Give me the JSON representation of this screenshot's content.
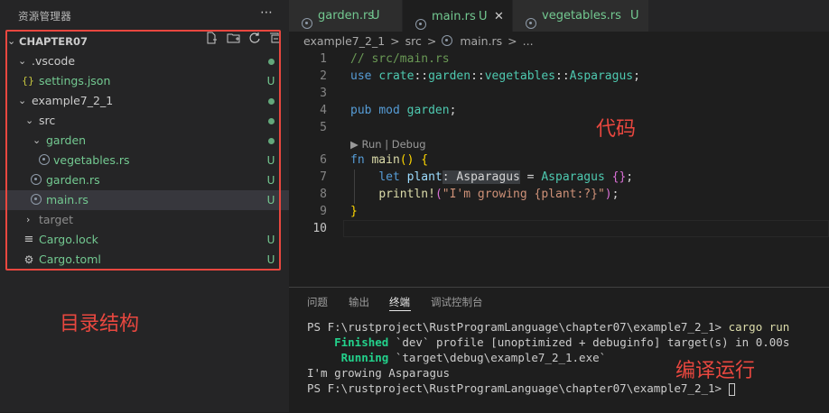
{
  "sidebar": {
    "title": "资源管理器",
    "more_icon": "ellipsis-icon",
    "folder_name": "CHAPTER07",
    "header_icons": [
      "new-file-icon",
      "new-folder-icon",
      "refresh-icon",
      "collapse-all-icon"
    ],
    "items": [
      {
        "label": ".vscode",
        "status": "dot"
      },
      {
        "label": "settings.json",
        "icon_text": "{}",
        "status": "U"
      },
      {
        "label": "example7_2_1",
        "status": "dot"
      },
      {
        "label": "src",
        "status": "dot"
      },
      {
        "label": "garden",
        "status": "dot"
      },
      {
        "label": "vegetables.rs",
        "status": "U"
      },
      {
        "label": "garden.rs",
        "status": "U"
      },
      {
        "label": "main.rs",
        "status": "U"
      },
      {
        "label": "target",
        "status": ""
      },
      {
        "label": "Cargo.lock",
        "icon_text": "≡",
        "status": "U"
      },
      {
        "label": "Cargo.toml",
        "icon_text": "⚙",
        "status": "U"
      }
    ]
  },
  "tabs": [
    {
      "name": "garden.rs",
      "status": "U"
    },
    {
      "name": "main.rs",
      "status": "U",
      "close": "✕"
    },
    {
      "name": "vegetables.rs",
      "status": "U"
    }
  ],
  "breadcrumb": [
    "example7_2_1",
    ">",
    "src",
    ">",
    "main.rs",
    ">",
    "..."
  ],
  "editor": {
    "line_numbers": [
      "1",
      "2",
      "3",
      "4",
      "5",
      "6",
      "7",
      "8",
      "9",
      "10"
    ],
    "codelens": "▶ Run | Debug",
    "lines": {
      "l1": "// src/main.rs",
      "l2_kw": "use",
      "l2_mod1": "crate",
      "l2_sep1": "::",
      "l2_mod2": "garden",
      "l2_sep2": "::",
      "l2_mod3": "vegetables",
      "l2_sep3": "::",
      "l2_ty": "Asparagus",
      "l2_end": ";",
      "l4_kw1": "pub",
      "l4_kw2": "mod",
      "l4_name": "garden",
      "l4_end": ";",
      "l6_kw": "fn",
      "l6_name": "main",
      "l6_parens": "()",
      "l6_brace": "{",
      "l7_kw": "let",
      "l7_var": "plant",
      "l7_hint": ": Asparagus",
      "l7_eq": " = ",
      "l7_ty": "Asparagus",
      "l7_braces": "{}",
      "l7_end": ";",
      "l8_macro": "println!",
      "l8_open": "(",
      "l8_str": "\"I'm growing {plant:?}\"",
      "l8_close": ")",
      "l8_end": ";",
      "l9_brace": "}"
    }
  },
  "panel": {
    "tabs": [
      "问题",
      "输出",
      "终端",
      "调试控制台"
    ],
    "active_tab": "终端",
    "terminal": {
      "prompt1": "PS F:\\rustproject\\RustProgramLanguage\\chapter07\\example7_2_1> ",
      "cmd1": "cargo run",
      "finished_word": "Finished",
      "finished_rest": " `dev` profile [unoptimized + debuginfo] target(s) in 0.00s",
      "running_word": "Running",
      "running_rest": " `target\\debug\\example7_2_1.exe`",
      "output": "I'm growing Asparagus",
      "prompt2": "PS F:\\rustproject\\RustProgramLanguage\\chapter07\\example7_2_1> "
    }
  },
  "annotations": {
    "code": "代码",
    "structure": "目录结构",
    "build_run": "编译运行",
    "color": "#e8473f"
  }
}
